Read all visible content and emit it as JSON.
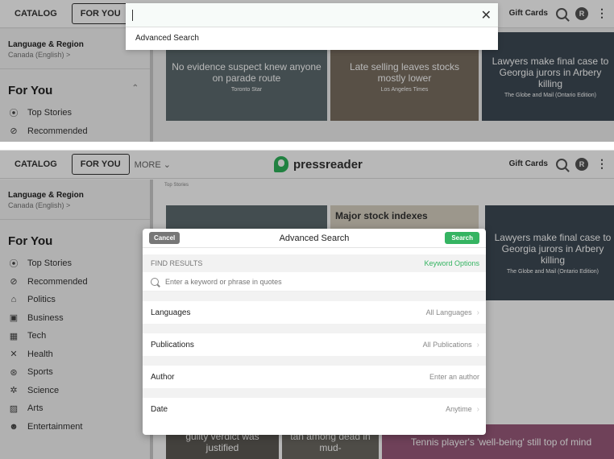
{
  "nav": {
    "catalog": "CATALOG",
    "for_you": "FOR YOU",
    "more": "MORE",
    "logo": "pressreader",
    "gift_cards": "Gift Cards",
    "avatar_initial": "R"
  },
  "sidebar": {
    "lang_title": "Language & Region",
    "lang_value": "Canada (English) >",
    "section_title": "For You",
    "categories": [
      {
        "label": "Top Stories",
        "icon": "trending-icon"
      },
      {
        "label": "Recommended",
        "icon": "check-circle-icon"
      },
      {
        "label": "Politics",
        "icon": "government-icon"
      },
      {
        "label": "Business",
        "icon": "briefcase-icon"
      },
      {
        "label": "Tech",
        "icon": "chip-icon"
      },
      {
        "label": "Health",
        "icon": "health-icon"
      },
      {
        "label": "Sports",
        "icon": "ball-icon"
      },
      {
        "label": "Science",
        "icon": "atom-icon"
      },
      {
        "label": "Arts",
        "icon": "arts-icon"
      },
      {
        "label": "Entertainment",
        "icon": "masks-icon"
      }
    ]
  },
  "content": {
    "breadcrumb": "Top Stories",
    "tiles": [
      {
        "title": "No evidence suspect knew anyone on parade route",
        "source": "Toronto Star"
      },
      {
        "title": "Major stock indexes",
        "subtitle": "Late selling leaves stocks mostly lower",
        "source": "Los Angeles Times"
      },
      {
        "title": "Lawyers make final case to Georgia jurors in Arbery killing",
        "source": "The Globe and Mail (Ontario Edition)"
      },
      {
        "title": "guilty verdict was justified"
      },
      {
        "title": "tan among dead in mud-"
      },
      {
        "title": "Tennis player's 'well-being' still top of mind"
      }
    ]
  },
  "search_popup": {
    "value": "",
    "advanced_link": "Advanced Search"
  },
  "modal": {
    "title": "Advanced Search",
    "cancel": "Cancel",
    "search": "Search",
    "find_results": "FIND RESULTS",
    "keyword_options": "Keyword Options",
    "keyword_placeholder": "Enter a keyword or phrase in quotes",
    "rows": [
      {
        "label": "Languages",
        "value": "All Languages"
      },
      {
        "label": "Publications",
        "value": "All Publications"
      },
      {
        "label": "Author",
        "value": "Enter an author"
      },
      {
        "label": "Date",
        "value": "Anytime"
      }
    ]
  },
  "colors": {
    "accent_green": "#35b462",
    "cancel_gray": "#777777"
  }
}
